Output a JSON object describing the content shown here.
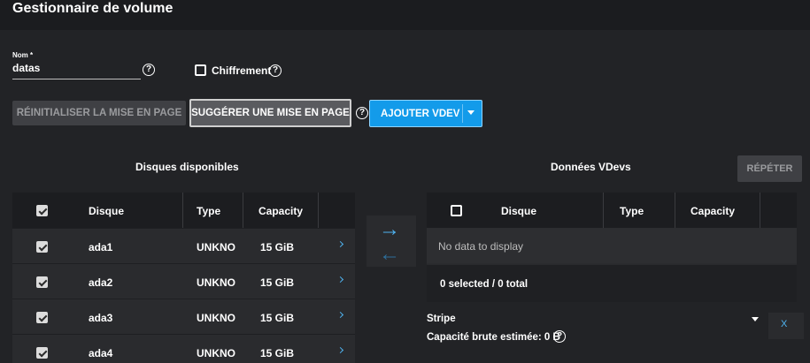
{
  "header": {
    "title": "Gestionnaire de volume"
  },
  "name_field": {
    "label": "Nom *",
    "value": "datas"
  },
  "encryption": {
    "label": "Chiffrement",
    "checked": false
  },
  "buttons": {
    "reset": "RÉINITIALISER LA MISE EN PAGE",
    "suggest": "SUGGÉRER UNE MISE EN PAGE",
    "add_vdev": "AJOUTER VDEV",
    "repeat": "RÉPÉTER"
  },
  "available_disks": {
    "title": "Disques disponibles",
    "columns": [
      "Disque",
      "Type",
      "Capacity"
    ],
    "rows": [
      {
        "disk": "ada1",
        "type": "UNKNO",
        "capacity": "15 GiB",
        "checked": true
      },
      {
        "disk": "ada2",
        "type": "UNKNO",
        "capacity": "15 GiB",
        "checked": true
      },
      {
        "disk": "ada3",
        "type": "UNKNO",
        "capacity": "15 GiB",
        "checked": true
      },
      {
        "disk": "ada4",
        "type": "UNKNO",
        "capacity": "15 GiB",
        "checked": true
      }
    ]
  },
  "data_vdevs": {
    "title": "Données VDevs",
    "columns": [
      "Disque",
      "Type",
      "Capacity"
    ],
    "empty_text": "No data to display",
    "footer": "0 selected / 0 total",
    "layout": "Stripe",
    "close_label": "X",
    "capacity_label": "Capacité brute estimée: 0 B"
  },
  "icons": {
    "help": "help-circle-icon",
    "move_right": "arrow-right-icon",
    "move_left": "arrow-left-icon",
    "row_expand": "chevron-right-icon",
    "dropdown": "caret-down-icon"
  },
  "colors": {
    "accent": "#139bea",
    "background": "#222326",
    "header": "#1b1c1f"
  }
}
